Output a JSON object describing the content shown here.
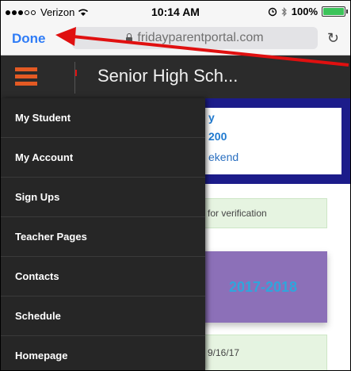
{
  "status_bar": {
    "carrier": "Verizon",
    "time": "10:14 AM",
    "battery_percent": "100%",
    "battery_level": 1.0
  },
  "browser": {
    "done_label": "Done",
    "url": "fridayparentportal.com"
  },
  "header": {
    "title": "Senior High Sch..."
  },
  "menu": {
    "items": [
      {
        "label": "My Student"
      },
      {
        "label": "My Account"
      },
      {
        "label": "Sign Ups"
      },
      {
        "label": "Teacher Pages"
      },
      {
        "label": "Contacts"
      },
      {
        "label": "Schedule"
      },
      {
        "label": "Homepage"
      }
    ]
  },
  "background_content": {
    "card_line1": "y",
    "card_line2": "200",
    "card_line3": "ekend",
    "verification_text": "for verification",
    "year_text": "2017-2018",
    "date_text": "9/16/17"
  },
  "colors": {
    "accent_blue": "#2f7cf6",
    "hamburger_orange": "#e45a23",
    "menu_bg": "#262626",
    "annotation_red": "#e01010"
  },
  "icons": {
    "lock": "lock-icon",
    "reload": "reload-icon",
    "menu": "hamburger-icon",
    "wifi": "wifi-icon",
    "alarm": "alarm-icon",
    "bluetooth": "bluetooth-icon",
    "battery": "battery-icon"
  }
}
